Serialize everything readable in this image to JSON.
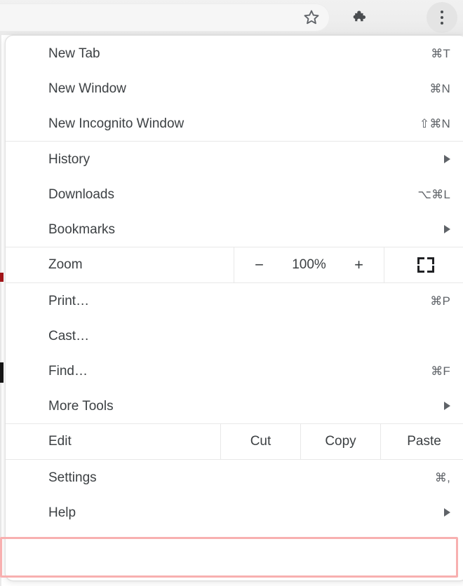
{
  "toolbar": {
    "bookmark_icon": "star-icon",
    "extensions_icon": "puzzle-piece-icon",
    "menu_icon": "three-dot-menu-icon"
  },
  "menu": {
    "sections": [
      {
        "id": "new",
        "items": [
          {
            "label": "New Tab",
            "accel": "⌘T",
            "submenu": false
          },
          {
            "label": "New Window",
            "accel": "⌘N",
            "submenu": false
          },
          {
            "label": "New Incognito Window",
            "accel": "⇧⌘N",
            "submenu": false
          }
        ]
      },
      {
        "id": "browse",
        "items": [
          {
            "label": "History",
            "accel": "",
            "submenu": true
          },
          {
            "label": "Downloads",
            "accel": "⌥⌘L",
            "submenu": false
          },
          {
            "label": "Bookmarks",
            "accel": "",
            "submenu": true
          }
        ]
      },
      {
        "id": "zoom",
        "zoom_row": {
          "label": "Zoom",
          "decrease": "−",
          "value": "100%",
          "increase": "+",
          "fullscreen_icon": "fullscreen-icon"
        }
      },
      {
        "id": "tools",
        "items": [
          {
            "label": "Print…",
            "accel": "⌘P",
            "submenu": false
          },
          {
            "label": "Cast…",
            "accel": "",
            "submenu": false
          },
          {
            "label": "Find…",
            "accel": "⌘F",
            "submenu": false
          },
          {
            "label": "More Tools",
            "accel": "",
            "submenu": true
          }
        ]
      },
      {
        "id": "edit",
        "edit_row": {
          "label": "Edit",
          "cut": "Cut",
          "copy": "Copy",
          "paste": "Paste"
        }
      },
      {
        "id": "settings",
        "items": [
          {
            "label": "Settings",
            "accel": "⌘,",
            "submenu": false
          },
          {
            "label": "Help",
            "accel": "",
            "submenu": true
          }
        ]
      }
    ],
    "highlight": {
      "target": "Help",
      "border_color": "#f8b0b0"
    }
  },
  "colors": {
    "menu_background": "#ffffff",
    "text": "#3c4043",
    "accelerator_text": "#5f6368",
    "separator": "#e8e8e8",
    "toolbar_background": "#eeeeee",
    "highlight_border": "#f8b0b0"
  }
}
